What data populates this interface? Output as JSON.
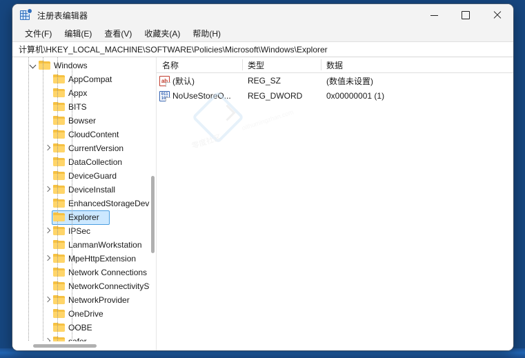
{
  "window": {
    "title": "注册表编辑器",
    "app_icon": "registry-editor-icon",
    "controls": {
      "minimize": "minimize-icon",
      "maximize": "maximize-icon",
      "close": "close-icon"
    }
  },
  "menubar": {
    "items": [
      {
        "label": "文件(F)",
        "name": "menu-file"
      },
      {
        "label": "编辑(E)",
        "name": "menu-edit"
      },
      {
        "label": "查看(V)",
        "name": "menu-view"
      },
      {
        "label": "收藏夹(A)",
        "name": "menu-favorites"
      },
      {
        "label": "帮助(H)",
        "name": "menu-help"
      }
    ]
  },
  "address": {
    "path": "计算机\\HKEY_LOCAL_MACHINE\\SOFTWARE\\Policies\\Microsoft\\Windows\\Explorer"
  },
  "tree": {
    "items": [
      {
        "label": "Windows",
        "depth": 3,
        "state": "expanded",
        "selected": false
      },
      {
        "label": "AppCompat",
        "depth": 4,
        "state": "leaf",
        "selected": false
      },
      {
        "label": "Appx",
        "depth": 4,
        "state": "leaf",
        "selected": false
      },
      {
        "label": "BITS",
        "depth": 4,
        "state": "leaf",
        "selected": false
      },
      {
        "label": "Bowser",
        "depth": 4,
        "state": "leaf",
        "selected": false
      },
      {
        "label": "CloudContent",
        "depth": 4,
        "state": "leaf",
        "selected": false
      },
      {
        "label": "CurrentVersion",
        "depth": 4,
        "state": "collapsed",
        "selected": false
      },
      {
        "label": "DataCollection",
        "depth": 4,
        "state": "leaf",
        "selected": false
      },
      {
        "label": "DeviceGuard",
        "depth": 4,
        "state": "leaf",
        "selected": false
      },
      {
        "label": "DeviceInstall",
        "depth": 4,
        "state": "collapsed",
        "selected": false
      },
      {
        "label": "EnhancedStorageDevices",
        "depth": 4,
        "state": "leaf",
        "selected": false
      },
      {
        "label": "Explorer",
        "depth": 4,
        "state": "leaf",
        "selected": true
      },
      {
        "label": "IPSec",
        "depth": 4,
        "state": "collapsed",
        "selected": false
      },
      {
        "label": "LanmanWorkstation",
        "depth": 4,
        "state": "leaf",
        "selected": false
      },
      {
        "label": "MpeHttpExtension",
        "depth": 4,
        "state": "collapsed",
        "selected": false
      },
      {
        "label": "Network Connections",
        "depth": 4,
        "state": "leaf",
        "selected": false
      },
      {
        "label": "NetworkConnectivityStatusIndicator",
        "depth": 4,
        "state": "leaf",
        "selected": false
      },
      {
        "label": "NetworkProvider",
        "depth": 4,
        "state": "collapsed",
        "selected": false
      },
      {
        "label": "OneDrive",
        "depth": 4,
        "state": "leaf",
        "selected": false
      },
      {
        "label": "OOBE",
        "depth": 4,
        "state": "leaf",
        "selected": false
      },
      {
        "label": "safer",
        "depth": 4,
        "state": "collapsed",
        "selected": false
      }
    ]
  },
  "list": {
    "columns": [
      {
        "label": "名称",
        "name": "column-name"
      },
      {
        "label": "类型",
        "name": "column-type"
      },
      {
        "label": "数据",
        "name": "column-data"
      }
    ],
    "rows": [
      {
        "icon": "string-value-icon",
        "icon_glyph": "ab",
        "name": "(默认)",
        "type": "REG_SZ",
        "data": "(数值未设置)"
      },
      {
        "icon": "dword-value-icon",
        "icon_glyph": "011\n100",
        "name": "NoUseStoreO...",
        "type": "REG_DWORD",
        "data": "0x00000001 (1)"
      }
    ]
  },
  "watermark": {
    "text": "零度社区",
    "text2": "oithumingzhan.com"
  },
  "colors": {
    "selection_fill": "#cce8ff",
    "selection_border": "#4a9ee0",
    "folder": "#ffd569",
    "accent": "#2f6fbf",
    "window_bg": "#f3f3f3",
    "pane_bg": "#ffffff"
  }
}
